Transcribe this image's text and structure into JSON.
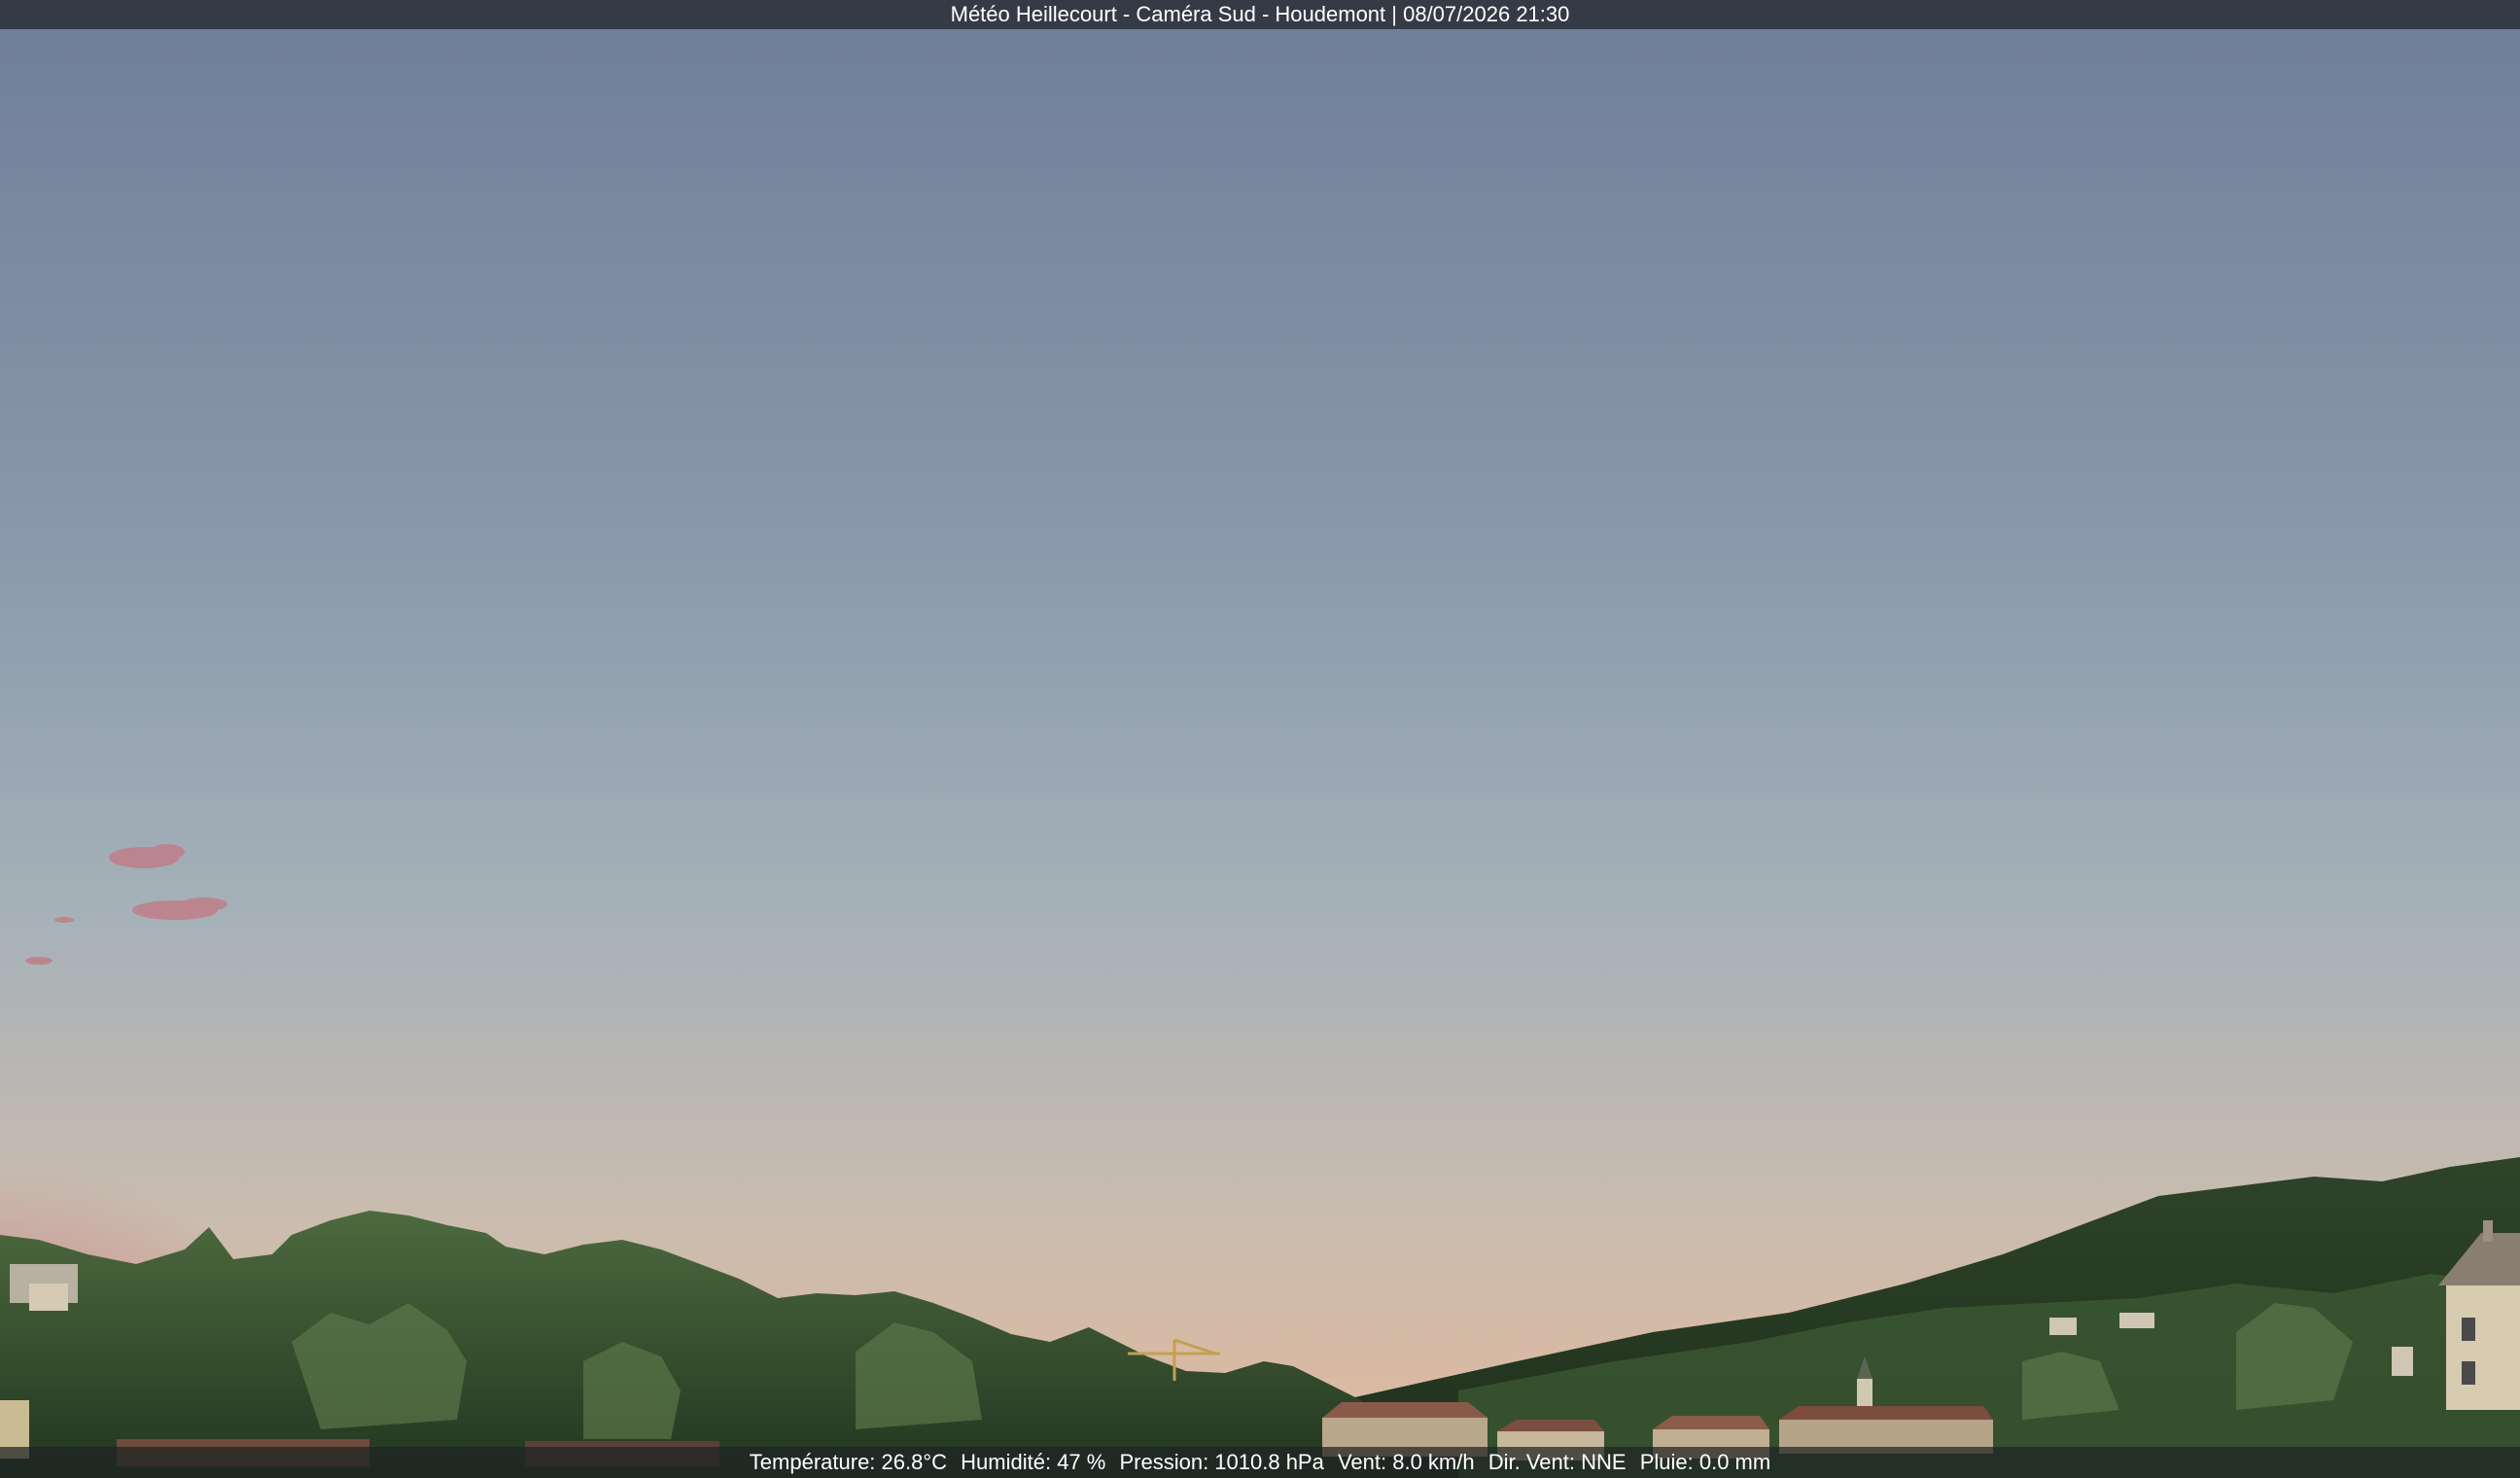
{
  "header": {
    "caption": "Météo Heillecourt - Caméra Sud - Houdemont | 08/07/2026 21:30"
  },
  "weather": {
    "temperature": "Température: 26.8°C",
    "humidity": "Humidité: 47 %",
    "pressure": "Pression: 1010.8 hPa",
    "wind": "Vent: 8.0 km/h",
    "wind_direction": "Dir. Vent: NNE",
    "rain": "Pluie: 0.0 mm"
  },
  "colors": {
    "sky_top": "#6f7e98",
    "sky_mid": "#9aa8b6",
    "sky_horizon": "#d9b8a0",
    "dusk_glow": "#c79a90",
    "tree_dark": "#253822",
    "tree_mid": "#3e5a34",
    "tree_light": "#5e7a4c",
    "roof": "#8a5a48",
    "wall": "#d8ccb0"
  }
}
